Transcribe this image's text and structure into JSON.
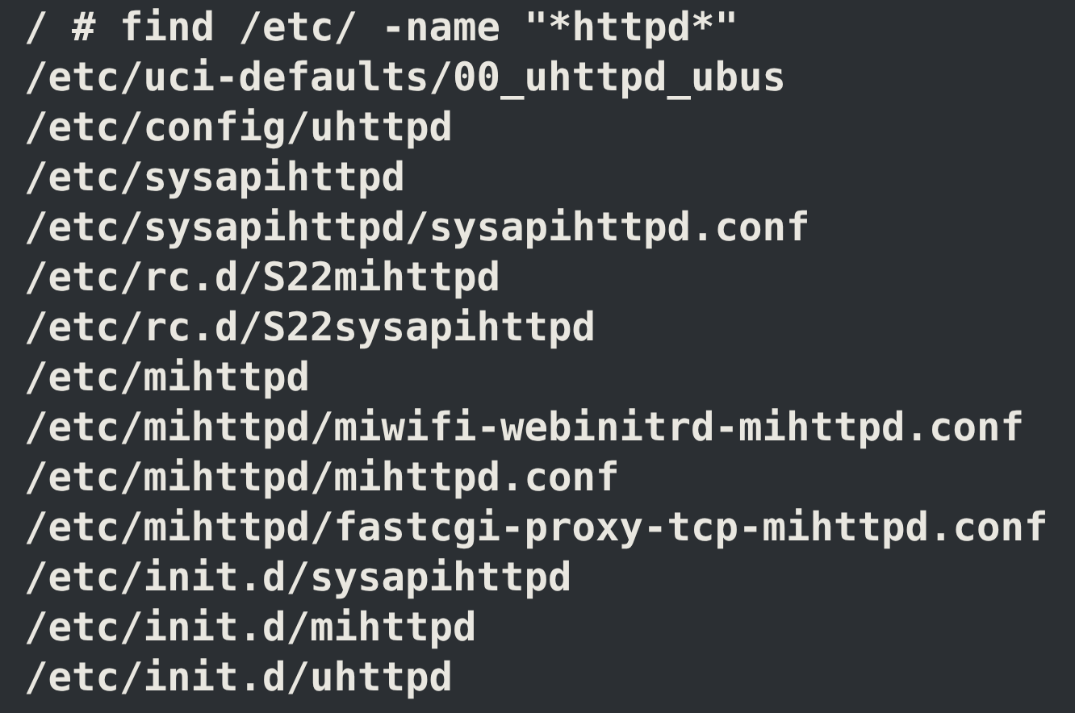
{
  "terminal": {
    "lines": [
      {
        "kind": "command",
        "prompt": "/ #",
        "text": "find /etc/ -name \"*httpd*\""
      },
      {
        "kind": "output",
        "text": "/etc/uci-defaults/00_uhttpd_ubus"
      },
      {
        "kind": "output",
        "text": "/etc/config/uhttpd"
      },
      {
        "kind": "output",
        "text": "/etc/sysapihttpd"
      },
      {
        "kind": "output",
        "text": "/etc/sysapihttpd/sysapihttpd.conf"
      },
      {
        "kind": "output",
        "text": "/etc/rc.d/S22mihttpd"
      },
      {
        "kind": "output",
        "text": "/etc/rc.d/S22sysapihttpd"
      },
      {
        "kind": "output",
        "text": "/etc/mihttpd"
      },
      {
        "kind": "output",
        "text": "/etc/mihttpd/miwifi-webinitrd-mihttpd.conf"
      },
      {
        "kind": "output",
        "text": "/etc/mihttpd/mihttpd.conf"
      },
      {
        "kind": "output",
        "text": "/etc/mihttpd/fastcgi-proxy-tcp-mihttpd.conf"
      },
      {
        "kind": "output",
        "text": "/etc/init.d/sysapihttpd"
      },
      {
        "kind": "output",
        "text": "/etc/init.d/mihttpd"
      },
      {
        "kind": "output",
        "text": "/etc/init.d/uhttpd"
      }
    ]
  }
}
